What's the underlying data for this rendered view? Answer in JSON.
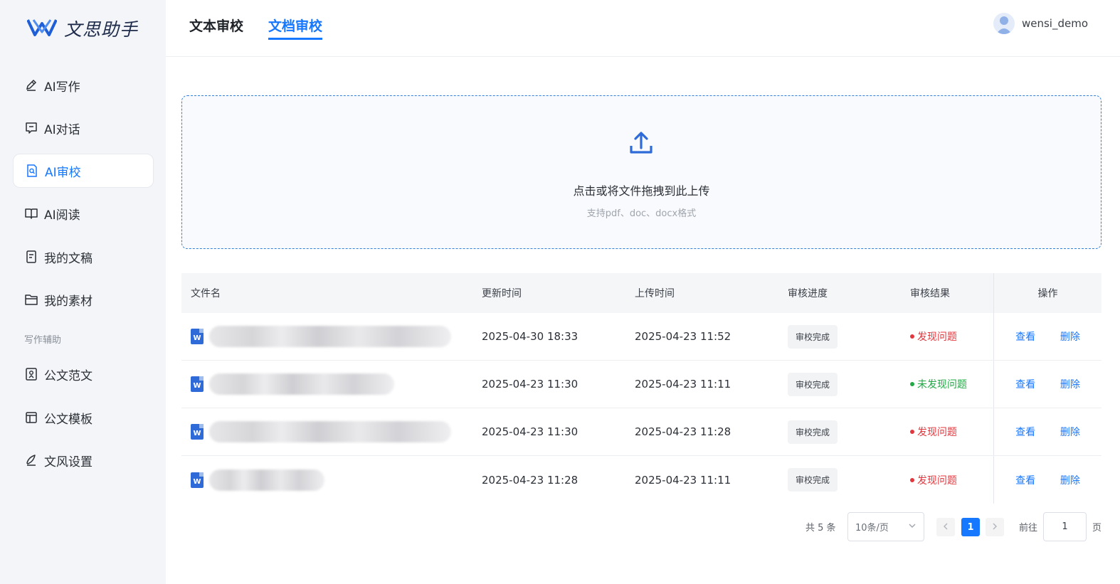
{
  "app": {
    "logo_text": "文思助手"
  },
  "sidebar": {
    "items": [
      {
        "label": "AI写作",
        "icon": "pen-icon"
      },
      {
        "label": "AI对话",
        "icon": "chat-icon"
      },
      {
        "label": "AI审校",
        "icon": "review-doc-icon",
        "active": true
      },
      {
        "label": "AI阅读",
        "icon": "book-icon"
      },
      {
        "label": "我的文稿",
        "icon": "document-icon"
      },
      {
        "label": "我的素材",
        "icon": "folder-icon"
      }
    ],
    "section_label": "写作辅助",
    "aux_items": [
      {
        "label": "公文范文",
        "icon": "sample-doc-icon"
      },
      {
        "label": "公文模板",
        "icon": "template-icon"
      },
      {
        "label": "文风设置",
        "icon": "style-pen-icon"
      }
    ]
  },
  "header": {
    "tabs": [
      {
        "label": "文本审校",
        "active": false
      },
      {
        "label": "文档审校",
        "active": true
      }
    ],
    "username": "wensi_demo"
  },
  "upload": {
    "title": "点击或将文件拖拽到此上传",
    "hint": "支持pdf、doc、docx格式"
  },
  "table": {
    "columns": [
      "文件名",
      "更新时间",
      "上传时间",
      "审核进度",
      "审核结果",
      "操作"
    ],
    "rows": [
      {
        "updated": "2025-04-30 18:33",
        "uploaded": "2025-04-23 11:52",
        "progress": "审校完成",
        "result": "发现问题",
        "result_type": "issue",
        "view": "查看",
        "delete": "删除"
      },
      {
        "updated": "2025-04-23 11:30",
        "uploaded": "2025-04-23 11:11",
        "progress": "审校完成",
        "result": "未发现问题",
        "result_type": "ok",
        "view": "查看",
        "delete": "删除"
      },
      {
        "updated": "2025-04-23 11:30",
        "uploaded": "2025-04-23 11:28",
        "progress": "审校完成",
        "result": "发现问题",
        "result_type": "issue",
        "view": "查看",
        "delete": "删除"
      },
      {
        "updated": "2025-04-23 11:28",
        "uploaded": "2025-04-23 11:11",
        "progress": "审校完成",
        "result": "发现问题",
        "result_type": "issue",
        "view": "查看",
        "delete": "删除"
      }
    ]
  },
  "pagination": {
    "total": "共 5 条",
    "page_size": "10条/页",
    "current_page": "1",
    "goto_label": "前往",
    "goto_value": "1",
    "unit": "页"
  },
  "colors": {
    "accent": "#1677ff",
    "issue": "#e0383e",
    "ok": "#22a845"
  }
}
